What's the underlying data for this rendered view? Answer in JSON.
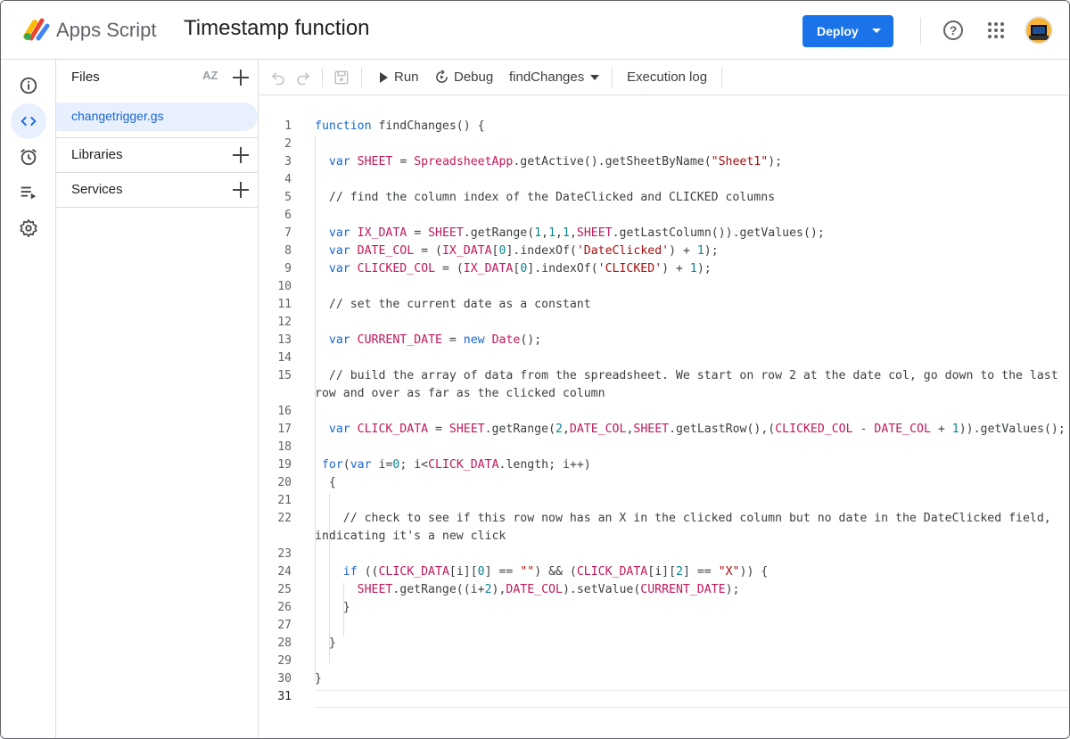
{
  "app": {
    "name": "Apps Script",
    "project_title": "Timestamp function"
  },
  "header": {
    "deploy_label": "Deploy",
    "help_icon": "help-icon",
    "apps_icon": "apps-grid-icon"
  },
  "rail": [
    {
      "name": "overview",
      "icon": "info-icon"
    },
    {
      "name": "editor",
      "icon": "code-icon",
      "active": true
    },
    {
      "name": "triggers",
      "icon": "alarm-clock-icon"
    },
    {
      "name": "executions",
      "icon": "executions-icon"
    },
    {
      "name": "settings",
      "icon": "gear-icon"
    }
  ],
  "files_panel": {
    "title": "Files",
    "sort_label": "AZ",
    "files": [
      "changetrigger.gs"
    ],
    "libraries_label": "Libraries",
    "services_label": "Services"
  },
  "toolbar": {
    "run_label": "Run",
    "debug_label": "Debug",
    "function_selected": "findChanges",
    "execution_log_label": "Execution log"
  },
  "editor": {
    "line_numbers": [
      "1",
      "2",
      "3",
      "4",
      "5",
      "6",
      "7",
      "8",
      "9",
      "10",
      "11",
      "12",
      "13",
      "14",
      "15",
      "16",
      "17",
      "18",
      "19",
      "20",
      "21",
      "22",
      "23",
      "24",
      "25",
      "26",
      "27",
      "28",
      "29",
      "30",
      "31"
    ],
    "lines": [
      "function findChanges() {",
      "",
      "  var SHEET = SpreadsheetApp.getActive().getSheetByName(\"Sheet1\");",
      "",
      "  // find the column index of the DateClicked and CLICKED columns",
      "",
      "  var IX_DATA = SHEET.getRange(1,1,1,SHEET.getLastColumn()).getValues();",
      "  var DATE_COL = (IX_DATA[0].indexOf('DateClicked') + 1);",
      "  var CLICKED_COL = (IX_DATA[0].indexOf('CLICKED') + 1);",
      "",
      "  // set the current date as a constant",
      "",
      "  var CURRENT_DATE = new Date();",
      "",
      "  // build the array of data from the spreadsheet. We start on row 2 at the date col, go down to the last row and over as far as the clicked column",
      "",
      "  var CLICK_DATA = SHEET.getRange(2,DATE_COL,SHEET.getLastRow(),(CLICKED_COL - DATE_COL + 1)).getValues();",
      "",
      " for(var i=0; i<CLICK_DATA.length; i++)",
      "  {",
      "",
      "    // check to see if this row now has an X in the clicked column but no date in the DateClicked field, indicating it's a new click",
      "",
      "    if ((CLICK_DATA[i][0] == \"\") && (CLICK_DATA[i][2] == \"X\")) {",
      "      SHEET.getRange((i+2),DATE_COL).setValue(CURRENT_DATE);",
      "    }",
      "",
      "  }",
      "",
      "}",
      ""
    ]
  }
}
